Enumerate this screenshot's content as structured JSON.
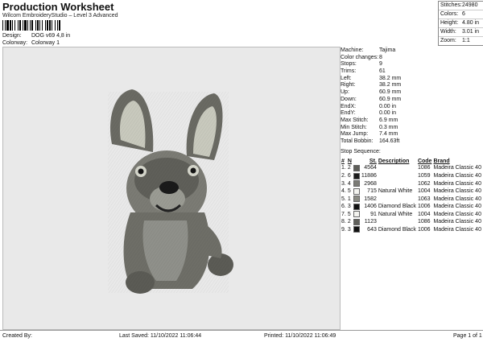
{
  "header": {
    "title": "Production Worksheet",
    "subtitle": "Wilcom EmbroideryStudio – Level 3 Advanced",
    "design_label": "Design:",
    "design_value": "DOG  v69 4,8 in",
    "colorway_label": "Colorway:",
    "colorway_value": "Colorway 1"
  },
  "stats": [
    {
      "k": "Stitches:",
      "v": "24980"
    },
    {
      "k": "Colors:",
      "v": "6"
    },
    {
      "k": "Height:",
      "v": "4.80 in"
    },
    {
      "k": "Width:",
      "v": "3.01 in"
    },
    {
      "k": "Zoom:",
      "v": "1:1"
    }
  ],
  "machine": [
    {
      "k": "Machine:",
      "v": "Tajima"
    },
    {
      "k": "Color changes:",
      "v": "8"
    },
    {
      "k": "Stops:",
      "v": "9"
    },
    {
      "k": "Trims:",
      "v": "61"
    },
    {
      "k": "Left:",
      "v": "38.2 mm"
    },
    {
      "k": "Right:",
      "v": "38.2 mm"
    },
    {
      "k": "Up:",
      "v": "60.9 mm"
    },
    {
      "k": "Down:",
      "v": "60.9 mm"
    },
    {
      "k": "EndX:",
      "v": "0.00 in"
    },
    {
      "k": "EndY:",
      "v": "0.00 in"
    },
    {
      "k": "Max Stitch:",
      "v": "6.9 mm"
    },
    {
      "k": "Min Stitch:",
      "v": "0.3 mm"
    },
    {
      "k": "Max Jump:",
      "v": "7.4 mm"
    },
    {
      "k": "Total Bobbin:",
      "v": "164.63ft"
    }
  ],
  "stop_sequence": {
    "heading": "Stop Sequence:",
    "columns": [
      "#",
      "N",
      "St.",
      "Description",
      "Code",
      "Brand"
    ],
    "rows": [
      {
        "n": "1.",
        "c": "2",
        "color": "#5f5f5a",
        "st": "4564",
        "desc": "",
        "code": "1086",
        "brand": "Madeira Classic 40"
      },
      {
        "n": "2.",
        "c": "6",
        "color": "#1c1c1c",
        "st": "11886",
        "desc": "",
        "code": "1059",
        "brand": "Madeira Classic 40"
      },
      {
        "n": "3.",
        "c": "4",
        "color": "#7b7b76",
        "st": "2968",
        "desc": "",
        "code": "1062",
        "brand": "Madeira Classic 40"
      },
      {
        "n": "4.",
        "c": "5",
        "color": "#f3f3ef",
        "st": "715",
        "desc": "Natural White",
        "code": "1004",
        "brand": "Madeira Classic 40"
      },
      {
        "n": "5.",
        "c": "1",
        "color": "#8a8b83",
        "st": "1582",
        "desc": "",
        "code": "1063",
        "brand": "Madeira Classic 40"
      },
      {
        "n": "6.",
        "c": "3",
        "color": "#111111",
        "st": "1406",
        "desc": "Diamond Black",
        "code": "1006",
        "brand": "Madeira Classic 40"
      },
      {
        "n": "7.",
        "c": "5",
        "color": "#f3f3ef",
        "st": "91",
        "desc": "Natural White",
        "code": "1004",
        "brand": "Madeira Classic 40"
      },
      {
        "n": "8.",
        "c": "2",
        "color": "#5f5f5a",
        "st": "1123",
        "desc": "",
        "code": "1086",
        "brand": "Madeira Classic 40"
      },
      {
        "n": "9.",
        "c": "3",
        "color": "#111111",
        "st": "643",
        "desc": "Diamond Black",
        "code": "1006",
        "brand": "Madeira Classic 40"
      }
    ]
  },
  "footer": {
    "created_by": "Created By:",
    "last_saved": "Last Saved: 11/10/2022 11:06:44",
    "printed": "Printed: 11/10/2022 11:06:49",
    "page": "Page 1 of 1"
  }
}
